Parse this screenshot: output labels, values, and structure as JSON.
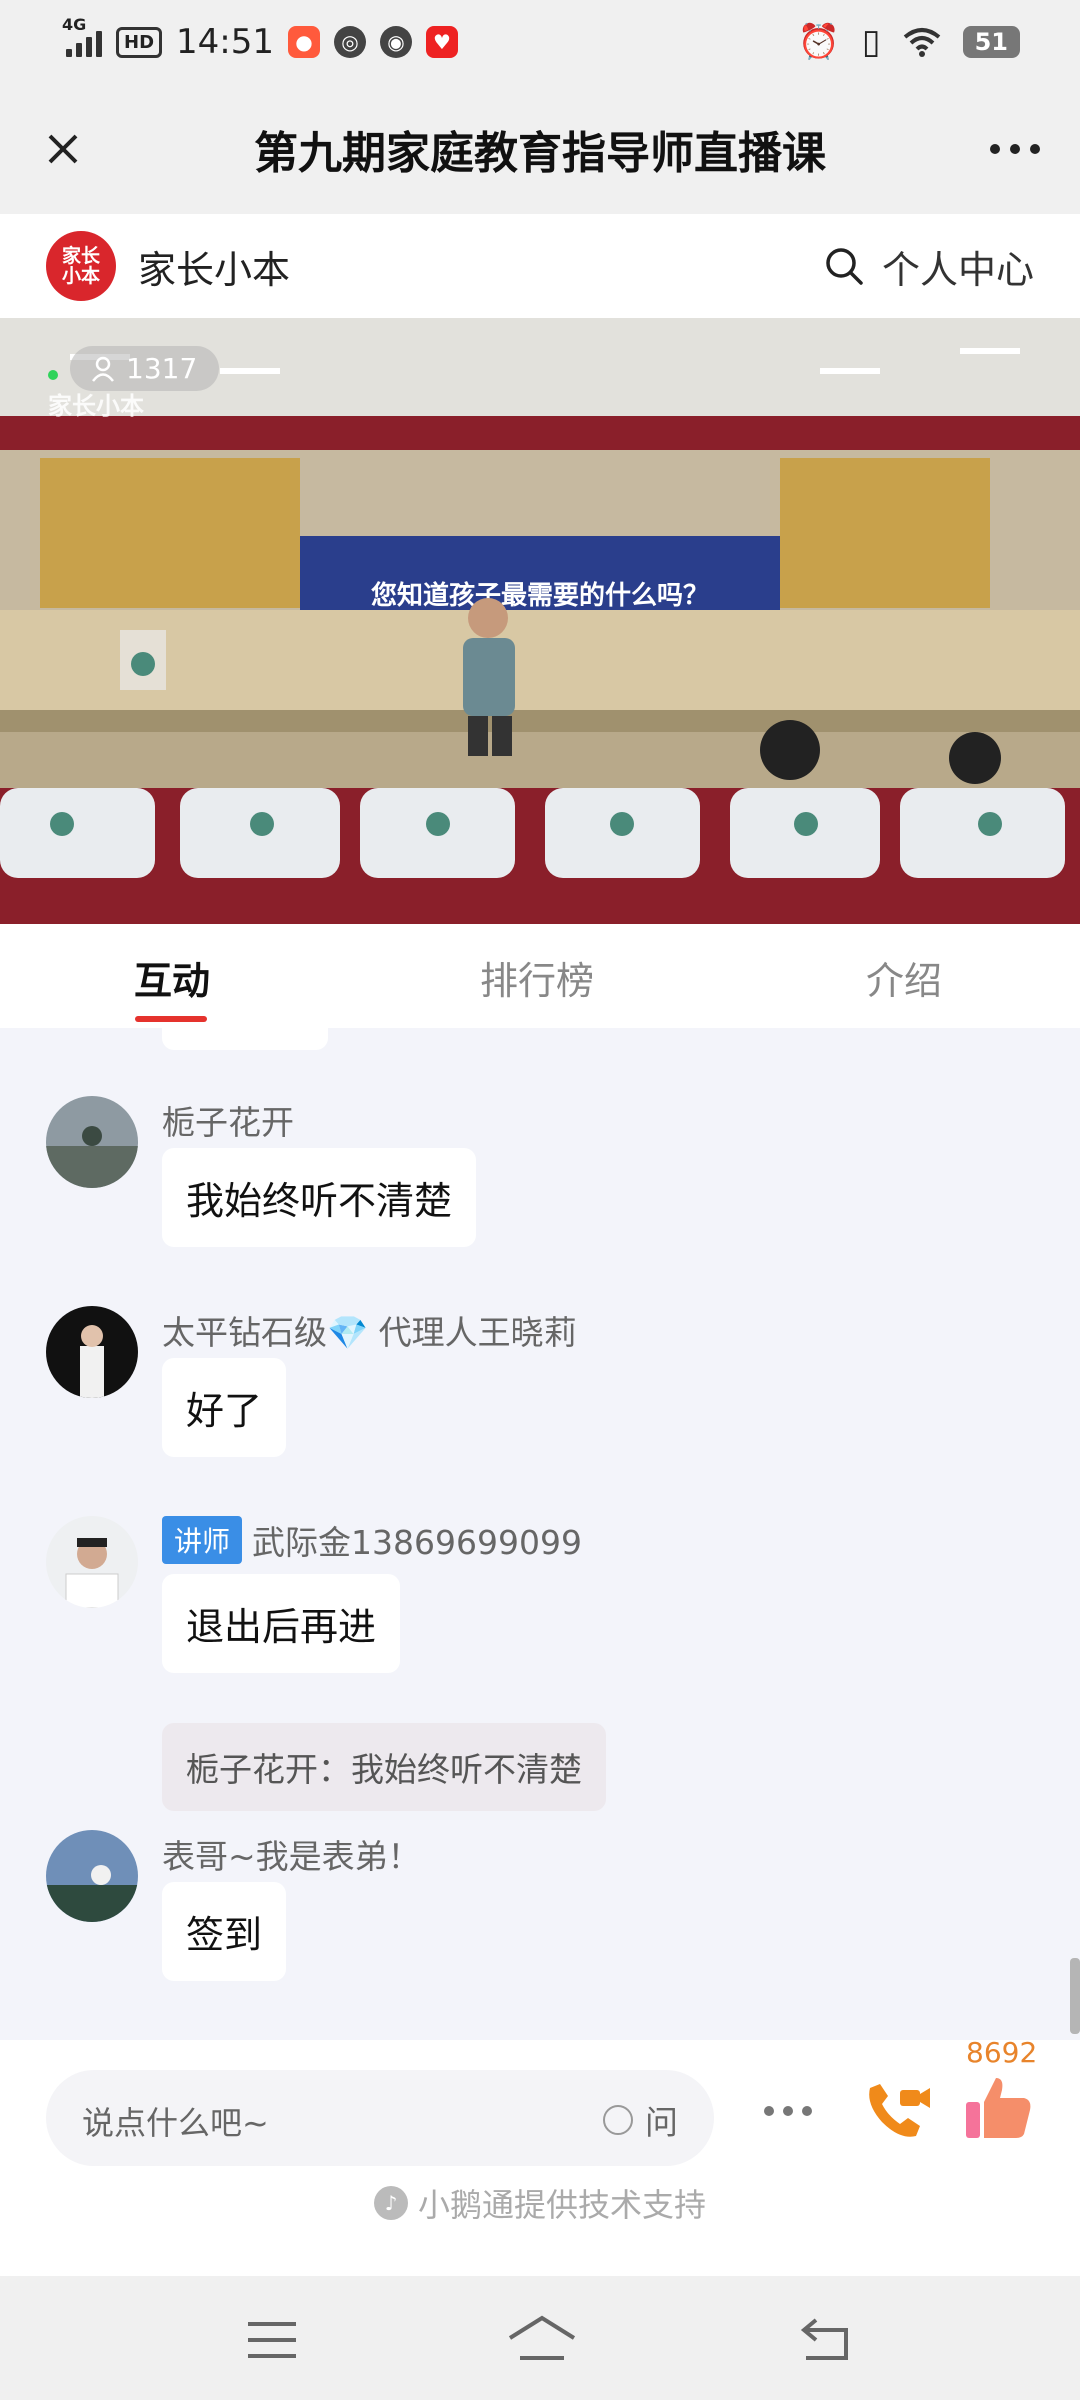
{
  "status_bar": {
    "network": "4G",
    "hd": "HD",
    "time": "14:51",
    "battery": "51"
  },
  "header": {
    "title": "第九期家庭教育指导师直播课"
  },
  "brand": {
    "logo_text_line1": "家长",
    "logo_text_line2": "小本",
    "name": "家长小本",
    "user_center": "个人中心"
  },
  "video": {
    "viewer_count": "1317",
    "watermark": "家长小本",
    "screen_text": "您知道孩子最需要的什么吗？"
  },
  "tabs": [
    {
      "label": "互动",
      "active": true
    },
    {
      "label": "排行榜",
      "active": false
    },
    {
      "label": "介绍",
      "active": false
    }
  ],
  "messages": [
    {
      "name": "栀子花开",
      "text": "我始终听不清楚"
    },
    {
      "name": "太平钻石级💎 代理人王晓莉",
      "text": "好了"
    },
    {
      "tag": "讲师",
      "name": "武际金13869699099",
      "text": "退出后再进",
      "quote": "栀子花开：我始终听不清楚"
    },
    {
      "name": "表哥~我是表弟！",
      "text": "签到"
    }
  ],
  "input": {
    "placeholder": "说点什么吧~",
    "ask_label": "问"
  },
  "likes": "8692",
  "footer": "小鹅通提供技术支持",
  "colors": {
    "accent_red": "#e5322d",
    "tag_blue": "#3a8ee6",
    "like_orange": "#e8842b"
  }
}
